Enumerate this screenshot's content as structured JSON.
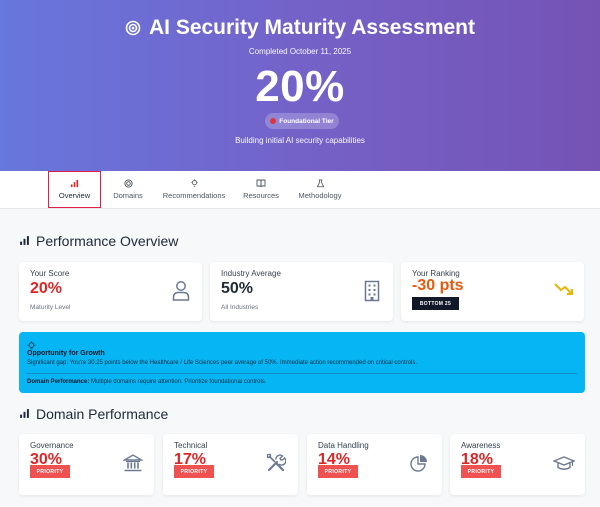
{
  "hero": {
    "title": "AI Security Maturity Assessment",
    "completed": "Completed October 11, 2025",
    "score": "20%",
    "tier": "Foundational Tier",
    "subtitle": "Building initial AI security capabilities",
    "icon": "target-icon"
  },
  "tabs": [
    {
      "label": "Overview",
      "icon": "bar-chart-icon",
      "active": true
    },
    {
      "label": "Domains",
      "icon": "target-icon"
    },
    {
      "label": "Recommendations",
      "icon": "lightbulb-icon"
    },
    {
      "label": "Resources",
      "icon": "book-icon"
    },
    {
      "label": "Methodology",
      "icon": "flask-icon"
    }
  ],
  "overview": {
    "title": "Performance Overview",
    "cards": [
      {
        "label": "Your Score",
        "value": "20%",
        "sub": "Maturity Level",
        "icon": "user-icon"
      },
      {
        "label": "Industry Average",
        "value": "50%",
        "sub": "All Industries",
        "icon": "building-icon"
      },
      {
        "label": "Your Ranking",
        "value": "-30 pts",
        "badge": "BOTTOM 25",
        "icon": "trending-down-icon"
      }
    ]
  },
  "alert": {
    "title": "Opportunity for Growth",
    "text": "Significant gap: You're 30.25 points below the Healthcare / Life Sciences peer average of 50%. Immediate action recommended on critical controls.",
    "foot_label": "Domain Performance:",
    "foot_text": " Multiple domains require attention. Prioritize foundational controls.",
    "icon": "lightbulb-icon"
  },
  "domains": {
    "title": "Domain Performance",
    "priority_label": "PRIORITY",
    "cards": [
      {
        "label": "Governance",
        "value": "30%",
        "icon": "institution-icon"
      },
      {
        "label": "Technical",
        "value": "17%",
        "icon": "tools-icon"
      },
      {
        "label": "Data Handling",
        "value": "14%",
        "icon": "pie-chart-icon"
      },
      {
        "label": "Awareness",
        "value": "18%",
        "icon": "graduation-cap-icon"
      }
    ]
  },
  "colors": {
    "hero_start": "#6777dd",
    "hero_end": "#7553b5",
    "danger": "#dc2626",
    "priority_badge": "#f05252",
    "alert_bg": "#06b6f4",
    "ranking_value": "#ea580c"
  }
}
